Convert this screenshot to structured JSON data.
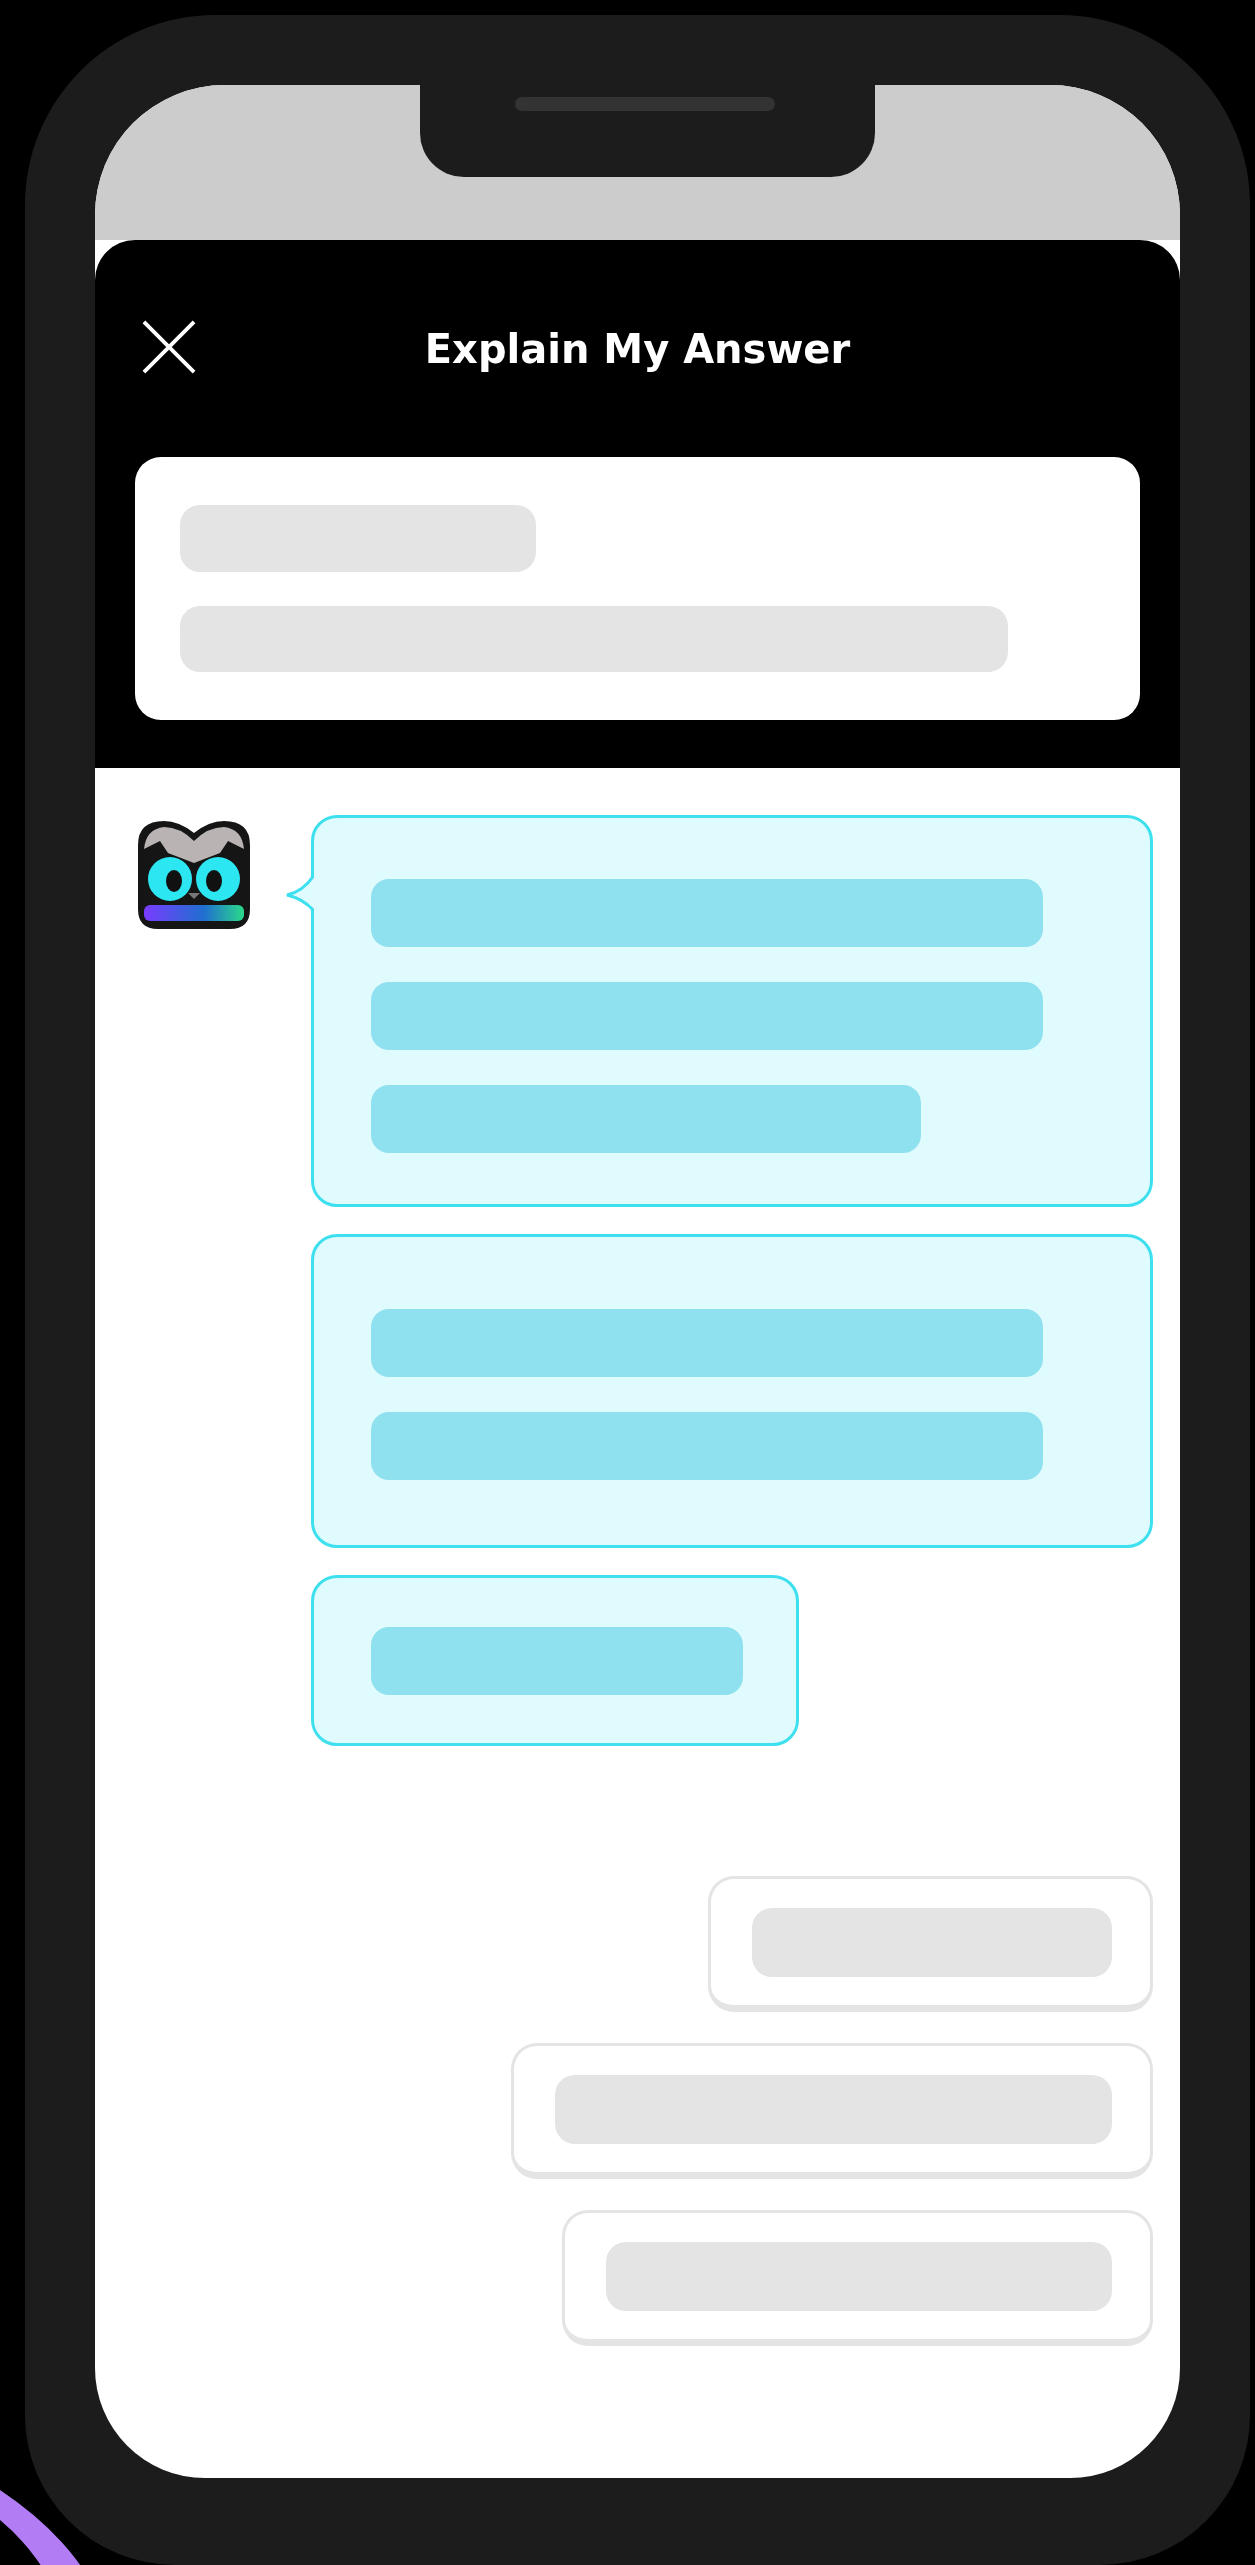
{
  "header": {
    "title": "Explain My Answer"
  }
}
